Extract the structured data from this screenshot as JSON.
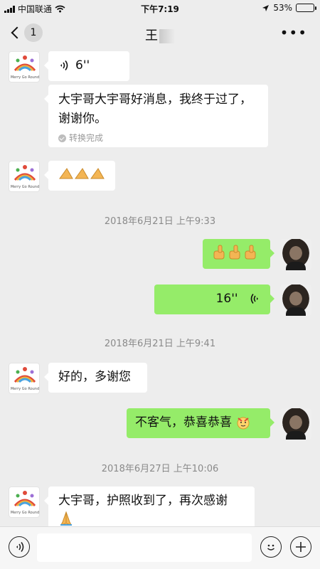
{
  "status_bar": {
    "carrier": "中国联通",
    "time": "下午7:19",
    "battery": "53%",
    "battery_level": 0.53
  },
  "nav": {
    "back_count": "1",
    "title": "王"
  },
  "messages": {
    "voice_in_duration": "6''",
    "transcript_text": "大宇哥大宇哥好消息，我终于过了，谢谢你。",
    "transcript_status": "转换完成",
    "ts1": "2018年6月21日 上午9:33",
    "voice_out_duration": "16''",
    "ts2": "2018年6月21日 上午9:41",
    "text_in_1": "好的，多谢您",
    "text_out_1": "不客气，恭喜恭喜",
    "ts3": "2018年6月27日 上午10:06",
    "text_in_2": "大宇哥，护照收到了，再次感谢"
  },
  "avatar": {
    "peer_caption": "Merry Go Round"
  },
  "colors": {
    "outgoing_bubble": "#95ec69",
    "incoming_bubble": "#ffffff",
    "background": "#ededed"
  }
}
